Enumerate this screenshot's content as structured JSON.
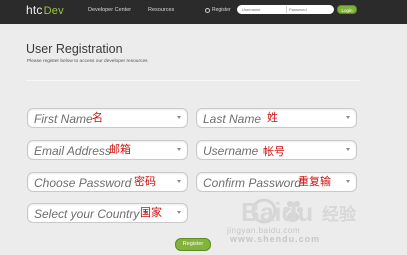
{
  "header": {
    "logo_main": "htc",
    "logo_accent": "Dev",
    "nav": [
      "Developer Center",
      "Resources"
    ],
    "register_link": "Register",
    "login": {
      "username_placeholder": "Username",
      "password_placeholder": "Password",
      "button_label": "Login"
    }
  },
  "page": {
    "title": "User Registration",
    "subtitle": "Please register below to access our developer resources"
  },
  "form": {
    "first_name": {
      "placeholder": "First Name",
      "annotation": "名"
    },
    "last_name": {
      "placeholder": "Last Name",
      "annotation": "姓"
    },
    "email": {
      "placeholder": "Email Address",
      "annotation": "邮箱"
    },
    "username": {
      "placeholder": "Username",
      "annotation": "帐号"
    },
    "password": {
      "placeholder": "Choose Password",
      "annotation": "密码"
    },
    "confirm_password": {
      "placeholder": "Confirm Password",
      "annotation": "重复输"
    },
    "country": {
      "placeholder": "Select your Country",
      "required_mark": "*",
      "annotation": "国家"
    },
    "submit_label": "Register"
  },
  "watermark": {
    "brand": "Baidu",
    "brand_cn": "经验",
    "url": "jingyan.baidu.com",
    "url2": "www.shendu.com"
  },
  "colors": {
    "accent_green": "#82b33a",
    "annotation_red": "#cc1111",
    "topbar": "#2b2b2b"
  }
}
